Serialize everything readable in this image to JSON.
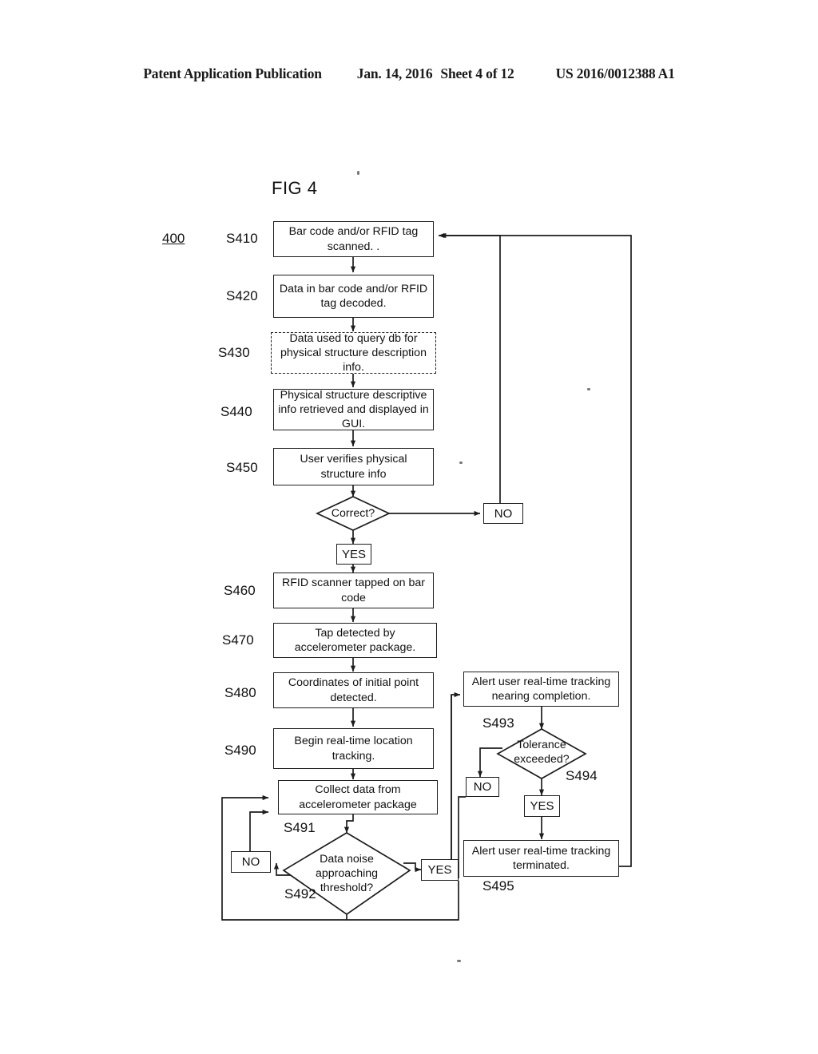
{
  "header": {
    "publication": "Patent Application Publication",
    "date": "Jan. 14, 2016",
    "sheet": "Sheet 4 of 12",
    "patent_number": "US 2016/0012388 A1"
  },
  "figure": {
    "title": "FIG 4",
    "reference_numeral": "400"
  },
  "steps": {
    "s410": {
      "label": "S410",
      "text": "Bar code and/or RFID tag scanned.  ."
    },
    "s420": {
      "label": "S420",
      "text": "Data in bar code and/or RFID tag decoded."
    },
    "s430": {
      "label": "S430",
      "text": "Data used to query db for physical structure description info."
    },
    "s440": {
      "label": "S440",
      "text": "Physical structure descriptive info retrieved and displayed in GUI."
    },
    "s450": {
      "label": "S450",
      "text": "User verifies physical structure info"
    },
    "s460": {
      "label": "S460",
      "text": "RFID scanner tapped on bar code"
    },
    "s470": {
      "label": "S470",
      "text": "Tap detected by accelerometer package."
    },
    "s480": {
      "label": "S480",
      "text": "Coordinates of initial point detected."
    },
    "s490": {
      "label": "S490",
      "text": "Begin real-time location tracking."
    },
    "s491": {
      "label": "S491",
      "text": "Collect data from accelerometer package"
    },
    "s492": {
      "label": "S492",
      "text": "Data noise approaching threshold?"
    },
    "s493": {
      "label": "S493",
      "text": "Alert user real-time tracking nearing completion."
    },
    "s494": {
      "label": "S494",
      "text": "Tolerance exceeded?"
    },
    "s495": {
      "label": "S495",
      "text": "Alert user real-time tracking terminated."
    }
  },
  "decisions": {
    "correct": {
      "text": "Correct?"
    }
  },
  "branch_tags": {
    "correct_no": "NO",
    "correct_yes": "YES",
    "noise_no": "NO",
    "noise_yes": "YES",
    "tolerance_no": "NO",
    "tolerance_yes": "YES"
  },
  "colors": {
    "ink": "#1d1d1d",
    "paper": "#ffffff"
  }
}
